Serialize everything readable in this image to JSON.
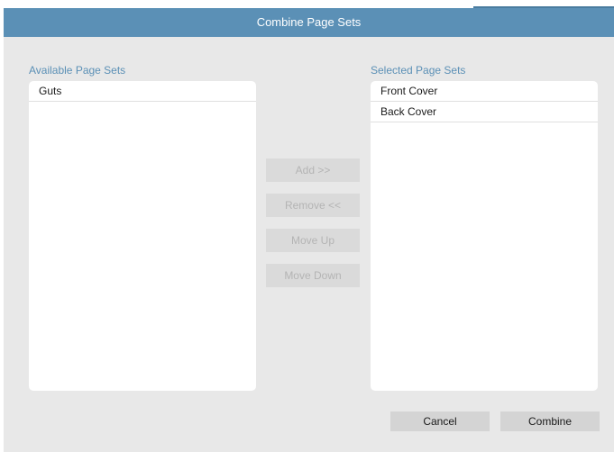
{
  "dialog": {
    "title": "Combine Page Sets"
  },
  "available": {
    "label": "Available Page Sets",
    "items": [
      "Guts"
    ]
  },
  "selected": {
    "label": "Selected Page Sets",
    "items": [
      "Front Cover",
      "Back Cover"
    ]
  },
  "controls": {
    "add_label": "Add >>",
    "remove_label": "Remove <<",
    "move_up_label": "Move Up",
    "move_down_label": "Move Down"
  },
  "footer": {
    "cancel_label": "Cancel",
    "combine_label": "Combine"
  },
  "colors": {
    "titlebar": "#5b90b6",
    "label_accent": "#5b90b6",
    "dialog_background": "#e8e8e8",
    "disabled_text": "#b4b4b4"
  }
}
